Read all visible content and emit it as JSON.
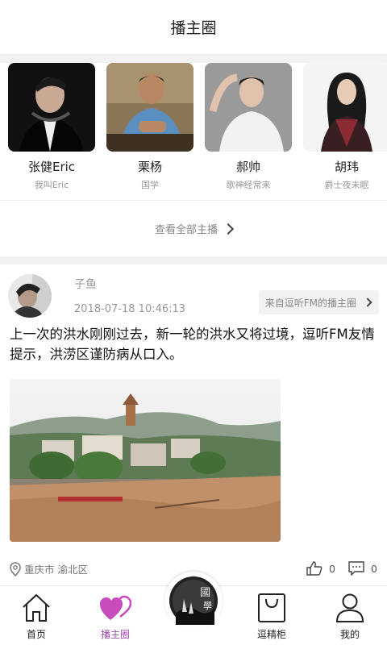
{
  "header": {
    "title": "播主圈"
  },
  "hosts": [
    {
      "name": "张健Eric",
      "desc": "我叫Eric"
    },
    {
      "name": "栗杨",
      "desc": "国学"
    },
    {
      "name": "郝帅",
      "desc": "歌神经常来"
    },
    {
      "name": "胡玮",
      "desc": "爵士夜未眠"
    }
  ],
  "view_all": {
    "label": "查看全部主播"
  },
  "post": {
    "author": "子鱼",
    "time": "2018-07-18 10:46:13",
    "source": "来自逗听FM的播主圈",
    "text": "上一次的洪水刚刚过去，新一轮的洪水又将过境，逗听FM友情提示，洪涝区谨防病从口入。",
    "location": "重庆市 渝北区",
    "likes": "0",
    "comments": "0"
  },
  "tabbar": {
    "tabs": [
      {
        "label": "首页"
      },
      {
        "label": "播主圈"
      },
      {
        "label": "逗精柜"
      },
      {
        "label": "我的"
      }
    ],
    "center_badge": "國學"
  },
  "colors": {
    "accent": "#a14bb0",
    "active_icon": "#c94cbd"
  }
}
